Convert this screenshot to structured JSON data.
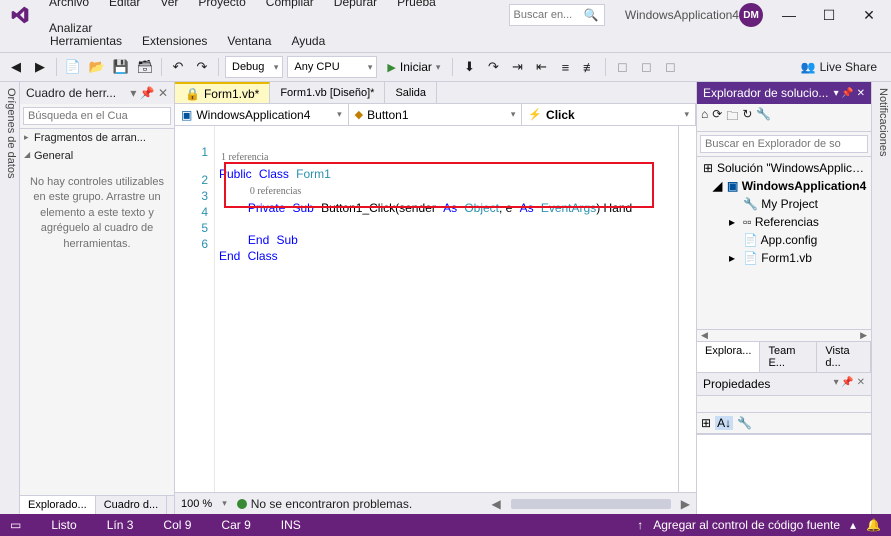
{
  "menu": {
    "m0": "Archivo",
    "m1": "Editar",
    "m2": "Ver",
    "m3": "Proyecto",
    "m4": "Compilar",
    "m5": "Depurar",
    "m6": "Prueba",
    "m7": "Analizar",
    "m8": "Herramientas",
    "m9": "Extensiones",
    "m10": "Ventana",
    "m11": "Ayuda"
  },
  "title_search_placeholder": "Buscar en...",
  "app_title": "WindowsApplication4",
  "avatar_initials": "DM",
  "toolbar": {
    "config": "Debug",
    "platform": "Any CPU",
    "run": "Iniciar",
    "liveshare": "Live Share"
  },
  "left_rail": "Orígenes de datos",
  "right_rail": "Notificaciones",
  "toolbox": {
    "title": "Cuadro de herr...",
    "search_placeholder": "Búsqueda en el Cua",
    "item_fragments": "Fragmentos de arran...",
    "item_general": "General",
    "empty_msg": "No hay controles utilizables en este grupo. Arrastre un elemento a este texto y agréguelo al cuadro de herramientas.",
    "tab_explorer": "Explorado...",
    "tab_toolbox": "Cuadro d..."
  },
  "doc_tabs": {
    "t0": "Form1.vb*",
    "t1": "Form1.vb [Diseño]*",
    "t2": "Salida"
  },
  "nav": {
    "scope": "WindowsApplication4",
    "member": "Button1",
    "event": "Click"
  },
  "code": {
    "ref1": "1 referencia",
    "ref0": "0 referencias",
    "l1a": "Public",
    "l1b": "Class",
    "l1c": "Form1",
    "l2a": "Private",
    "l2b": "Sub",
    "l2c": "Button1_Click(sender",
    "l2d": "As",
    "l2e": "Object",
    "l2f": ", e",
    "l2g": "As",
    "l2h": "EventArgs",
    "l2i": ") Hand",
    "l4a": "End",
    "l4b": "Sub",
    "l5a": "End",
    "l5b": "Class",
    "n1": "1",
    "n2": "2",
    "n3": "3",
    "n4": "4",
    "n5": "5",
    "n6": "6"
  },
  "editor_footer": {
    "zoom": "100 %",
    "noproblems": "No se encontraron problemas."
  },
  "solution": {
    "title": "Explorador de solucio...",
    "search_placeholder": "Buscar en Explorador de so",
    "root": "Solución \"WindowsApplicatio",
    "proj": "WindowsApplication4",
    "myproj": "My Project",
    "refs": "Referencias",
    "appcfg": "App.config",
    "form": "Form1.vb",
    "tab0": "Explora...",
    "tab1": "Team E...",
    "tab2": "Vista d..."
  },
  "props": {
    "title": "Propiedades"
  },
  "status": {
    "ready": "Listo",
    "line": "Lín 3",
    "col": "Col 9",
    "car": "Car 9",
    "ins": "INS",
    "sourcecontrol": "Agregar al control de código fuente"
  }
}
